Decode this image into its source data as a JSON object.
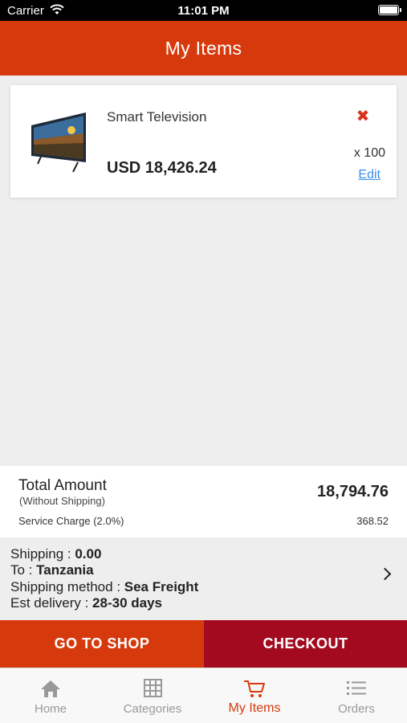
{
  "status_bar": {
    "carrier": "Carrier",
    "time": "11:01 PM"
  },
  "header": {
    "title": "My Items"
  },
  "cart_item": {
    "name": "Smart Television",
    "price": "USD 18,426.24",
    "quantity": "x 100",
    "edit_label": "Edit",
    "remove_icon": "close-icon"
  },
  "totals": {
    "label": "Total Amount",
    "sublabel": "(Without Shipping)",
    "amount": "18,794.76",
    "service_label": "Service Charge (2.0%)",
    "service_value": "368.52"
  },
  "shipping": {
    "cost_label": "Shipping : ",
    "cost_value": "0.00",
    "to_label": "To : ",
    "to_value": "Tanzania",
    "method_label": "Shipping method : ",
    "method_value": "Sea Freight",
    "delivery_label": "Est delivery : ",
    "delivery_value": "28-30 days"
  },
  "actions": {
    "shop_label": "GO TO SHOP",
    "checkout_label": "CHECKOUT"
  },
  "tabs": [
    {
      "label": "Home",
      "icon": "home-icon"
    },
    {
      "label": "Categories",
      "icon": "grid-icon"
    },
    {
      "label": "My Items",
      "icon": "cart-icon",
      "active": true
    },
    {
      "label": "Orders",
      "icon": "list-icon"
    }
  ],
  "colors": {
    "brand": "#d63a0c",
    "checkout": "#a30a1f",
    "remove": "#d8321f",
    "link": "#3a8ee6"
  }
}
